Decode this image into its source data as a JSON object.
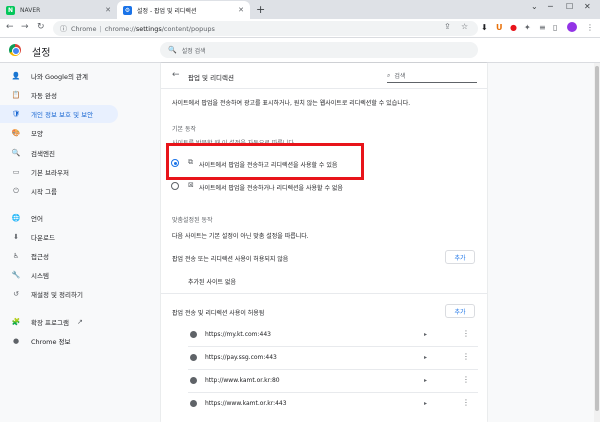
{
  "browser": {
    "tabs": [
      {
        "title": "NAVER",
        "favicon_color": "#03c75a",
        "favicon_letter": "N"
      },
      {
        "title": "설정 - 팝업 및 리디렉션",
        "favicon_color": "#1a73e8",
        "favicon_letter": "⚙"
      }
    ],
    "new_tab_symbol": "+",
    "address": {
      "scheme": "Chrome",
      "host": "chrome://",
      "path_bold": "settings",
      "path_rest": "/content/popups"
    }
  },
  "header": {
    "title": "설정",
    "search_placeholder": "설정 검색"
  },
  "sidebar": {
    "items": [
      {
        "label": "나와 Google의 관계",
        "icon": "person-icon",
        "glyph": "👤"
      },
      {
        "label": "자동 완성",
        "icon": "clipboard-icon",
        "glyph": "📋"
      },
      {
        "label": "개인 정보 보호 및 보안",
        "icon": "shield-icon",
        "glyph": "🛡",
        "active": true
      },
      {
        "label": "모양",
        "icon": "palette-icon",
        "glyph": "🎨"
      },
      {
        "label": "검색엔진",
        "icon": "search-icon",
        "glyph": "🔍"
      },
      {
        "label": "기본 브라우저",
        "icon": "browser-icon",
        "glyph": "▭"
      },
      {
        "label": "시작 그룹",
        "icon": "power-icon",
        "glyph": "⏻"
      },
      {
        "label": "언어",
        "icon": "globe-icon",
        "glyph": "🌐"
      },
      {
        "label": "다운로드",
        "icon": "download-icon",
        "glyph": "⬇"
      },
      {
        "label": "접근성",
        "icon": "accessibility-icon",
        "glyph": "♿"
      },
      {
        "label": "시스템",
        "icon": "wrench-icon",
        "glyph": "🔧"
      },
      {
        "label": "재설정 및 정리하기",
        "icon": "history-icon",
        "glyph": "↺"
      },
      {
        "label": "확장 프로그램",
        "icon": "puzzle-icon",
        "glyph": "🧩"
      },
      {
        "label": "Chrome 정보",
        "icon": "chrome-icon",
        "glyph": "●"
      }
    ]
  },
  "content": {
    "back_symbol": "←",
    "page_title": "팝업 및 리디렉션",
    "search_placeholder": "검색",
    "description": "사이트에서 팝업을 전송하여 광고를 표시하거나, 원치 않는 웹사이트로 리디렉션할 수 있습니다.",
    "default_heading": "기본 동작",
    "default_note": "사이트를 방문할 때 이 설정을 자동으로 따릅니다.",
    "options": [
      {
        "label": "사이트에서 팝업을 전송하고 리디렉션을 사용할 수 있음",
        "checked": true
      },
      {
        "label": "사이트에서 팝업을 전송하거나 리디렉션을 사용할 수 없음",
        "checked": false
      }
    ],
    "custom_heading": "맞춤설정된 동작",
    "custom_note": "다음 사이트는 기본 설정이 아닌 맞춤 설정을 따릅니다.",
    "blocked_heading": "팝업 전송 또는 리디렉션 사용이 허용되지 않음",
    "add_label": "추가",
    "blocked_empty": "추가된 사이트 없음",
    "allowed_heading": "팝업 전송 및 리디렉션 사용이 허용됨",
    "allowed_sites": [
      "https://my.kt.com:443",
      "https://pay.ssg.com:443",
      "http://www.kamt.or.kr:80",
      "https://www.kamt.or.kr:443"
    ]
  },
  "colors": {
    "accent": "#1a73e8",
    "highlight_box": "#e8141a",
    "sidebar_active_bg": "#e8f0fe"
  }
}
